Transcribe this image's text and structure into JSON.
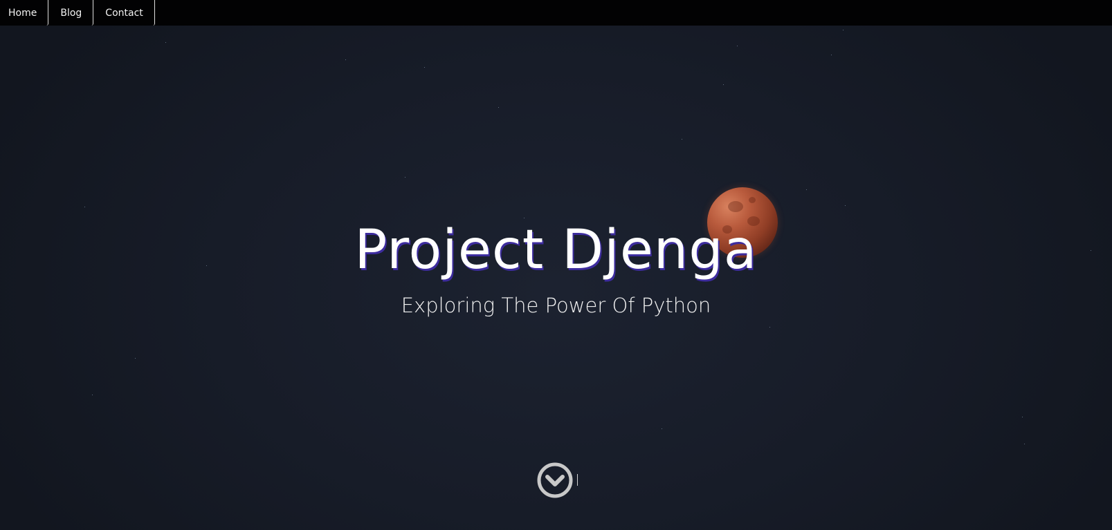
{
  "nav": {
    "items": [
      {
        "label": "Home"
      },
      {
        "label": "Blog"
      },
      {
        "label": "Contact"
      }
    ]
  },
  "hero": {
    "title": "Project Djenga",
    "subtitle": "Exploring The Power Of Python",
    "scroll_icon": "chevron-down-circle-icon"
  },
  "colors": {
    "background": "#151a25",
    "nav_background": "#020203",
    "title_shadow": "#3d2c9e",
    "moon": "#b85a3c",
    "icon": "#c8c8c8"
  }
}
